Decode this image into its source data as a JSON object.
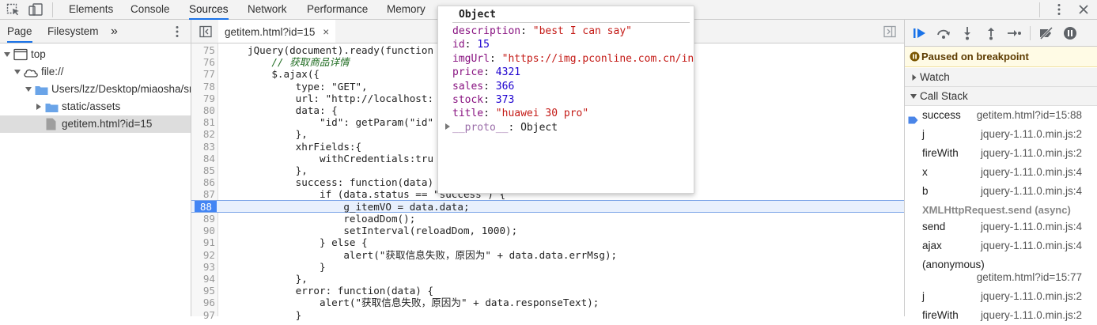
{
  "toolbar": {
    "tabs": [
      "Elements",
      "Console",
      "Sources",
      "Network",
      "Performance",
      "Memory"
    ],
    "active_tab": "Sources"
  },
  "navigator": {
    "tabs": [
      "Page",
      "Filesystem"
    ],
    "more": "»",
    "tree": [
      {
        "label": "top"
      },
      {
        "label": "file://"
      },
      {
        "label": "Users/lzz/Desktop/miaosha/src"
      },
      {
        "label": "static/assets"
      },
      {
        "label": "getitem.html?id=15"
      }
    ]
  },
  "editor": {
    "file_tab": "getitem.html?id=15",
    "close": "×",
    "lines": [
      {
        "n": "75",
        "text": "jQuery(document).ready(function"
      },
      {
        "n": "76",
        "text": "    // 获取商品详情"
      },
      {
        "n": "77",
        "text": "    $.ajax({"
      },
      {
        "n": "78",
        "text": "        type: \"GET\","
      },
      {
        "n": "79",
        "text": "        url: \"http://localhost:"
      },
      {
        "n": "80",
        "text": "        data: {"
      },
      {
        "n": "81",
        "text": "            \"id\": getParam(\"id\""
      },
      {
        "n": "82",
        "text": "        },"
      },
      {
        "n": "83",
        "text": "        xhrFields:{"
      },
      {
        "n": "84",
        "text": "            withCredentials:tru"
      },
      {
        "n": "85",
        "text": "        },"
      },
      {
        "n": "86",
        "text": "        success: function(data)"
      },
      {
        "n": "87",
        "text": "            if (data.status == \"success\") {"
      },
      {
        "n": "88",
        "text": "                g_itemVO = data.data;"
      },
      {
        "n": "89",
        "text": "                reloadDom();"
      },
      {
        "n": "90",
        "text": "                setInterval(reloadDom, 1000);"
      },
      {
        "n": "91",
        "text": "            } else {"
      },
      {
        "n": "92",
        "text": "                alert(\"获取信息失败，原因为\" + data.data.errMsg);"
      },
      {
        "n": "93",
        "text": "            }"
      },
      {
        "n": "94",
        "text": "        },"
      },
      {
        "n": "95",
        "text": "        error: function(data) {"
      },
      {
        "n": "96",
        "text": "            alert(\"获取信息失败，原因为\" + data.responseText);"
      },
      {
        "n": "97",
        "text": "        }"
      }
    ]
  },
  "popover": {
    "title": "Object",
    "props": [
      {
        "key": "description",
        "value": "\"best I can say\"",
        "kind": "str"
      },
      {
        "key": "id",
        "value": "15",
        "kind": "num"
      },
      {
        "key": "imgUrl",
        "value": "\"https://img.pconline.com.cn/in",
        "kind": "str"
      },
      {
        "key": "price",
        "value": "4321",
        "kind": "num"
      },
      {
        "key": "sales",
        "value": "366",
        "kind": "num"
      },
      {
        "key": "stock",
        "value": "373",
        "kind": "num"
      },
      {
        "key": "title",
        "value": "\"huawei 30 pro\"",
        "kind": "str"
      },
      {
        "key": "__proto__",
        "value": "Object",
        "kind": "plain"
      }
    ]
  },
  "debugger": {
    "paused_text": "Paused on breakpoint",
    "watch_label": "Watch",
    "callstack_label": "Call Stack",
    "frames": [
      {
        "fn": "success",
        "loc": "getitem.html?id=15:88"
      },
      {
        "fn": "j",
        "loc": "jquery-1.11.0.min.js:2"
      },
      {
        "fn": "fireWith",
        "loc": "jquery-1.11.0.min.js:2"
      },
      {
        "fn": "x",
        "loc": "jquery-1.11.0.min.js:4"
      },
      {
        "fn": "b",
        "loc": "jquery-1.11.0.min.js:4"
      }
    ],
    "async_label": "XMLHttpRequest.send (async)",
    "frames2": [
      {
        "fn": "send",
        "loc": "jquery-1.11.0.min.js:4"
      },
      {
        "fn": "ajax",
        "loc": "jquery-1.11.0.min.js:4"
      },
      {
        "fn": "(anonymous)",
        "loc": "getitem.html?id=15:77"
      },
      {
        "fn": "j",
        "loc": "jquery-1.11.0.min.js:2"
      },
      {
        "fn": "fireWith",
        "loc": "jquery-1.11.0.min.js:2"
      }
    ]
  },
  "colors": {
    "accent": "#1a73e8",
    "execution_line": "#e8f0fd",
    "paused_bg": "#fffbe5"
  }
}
